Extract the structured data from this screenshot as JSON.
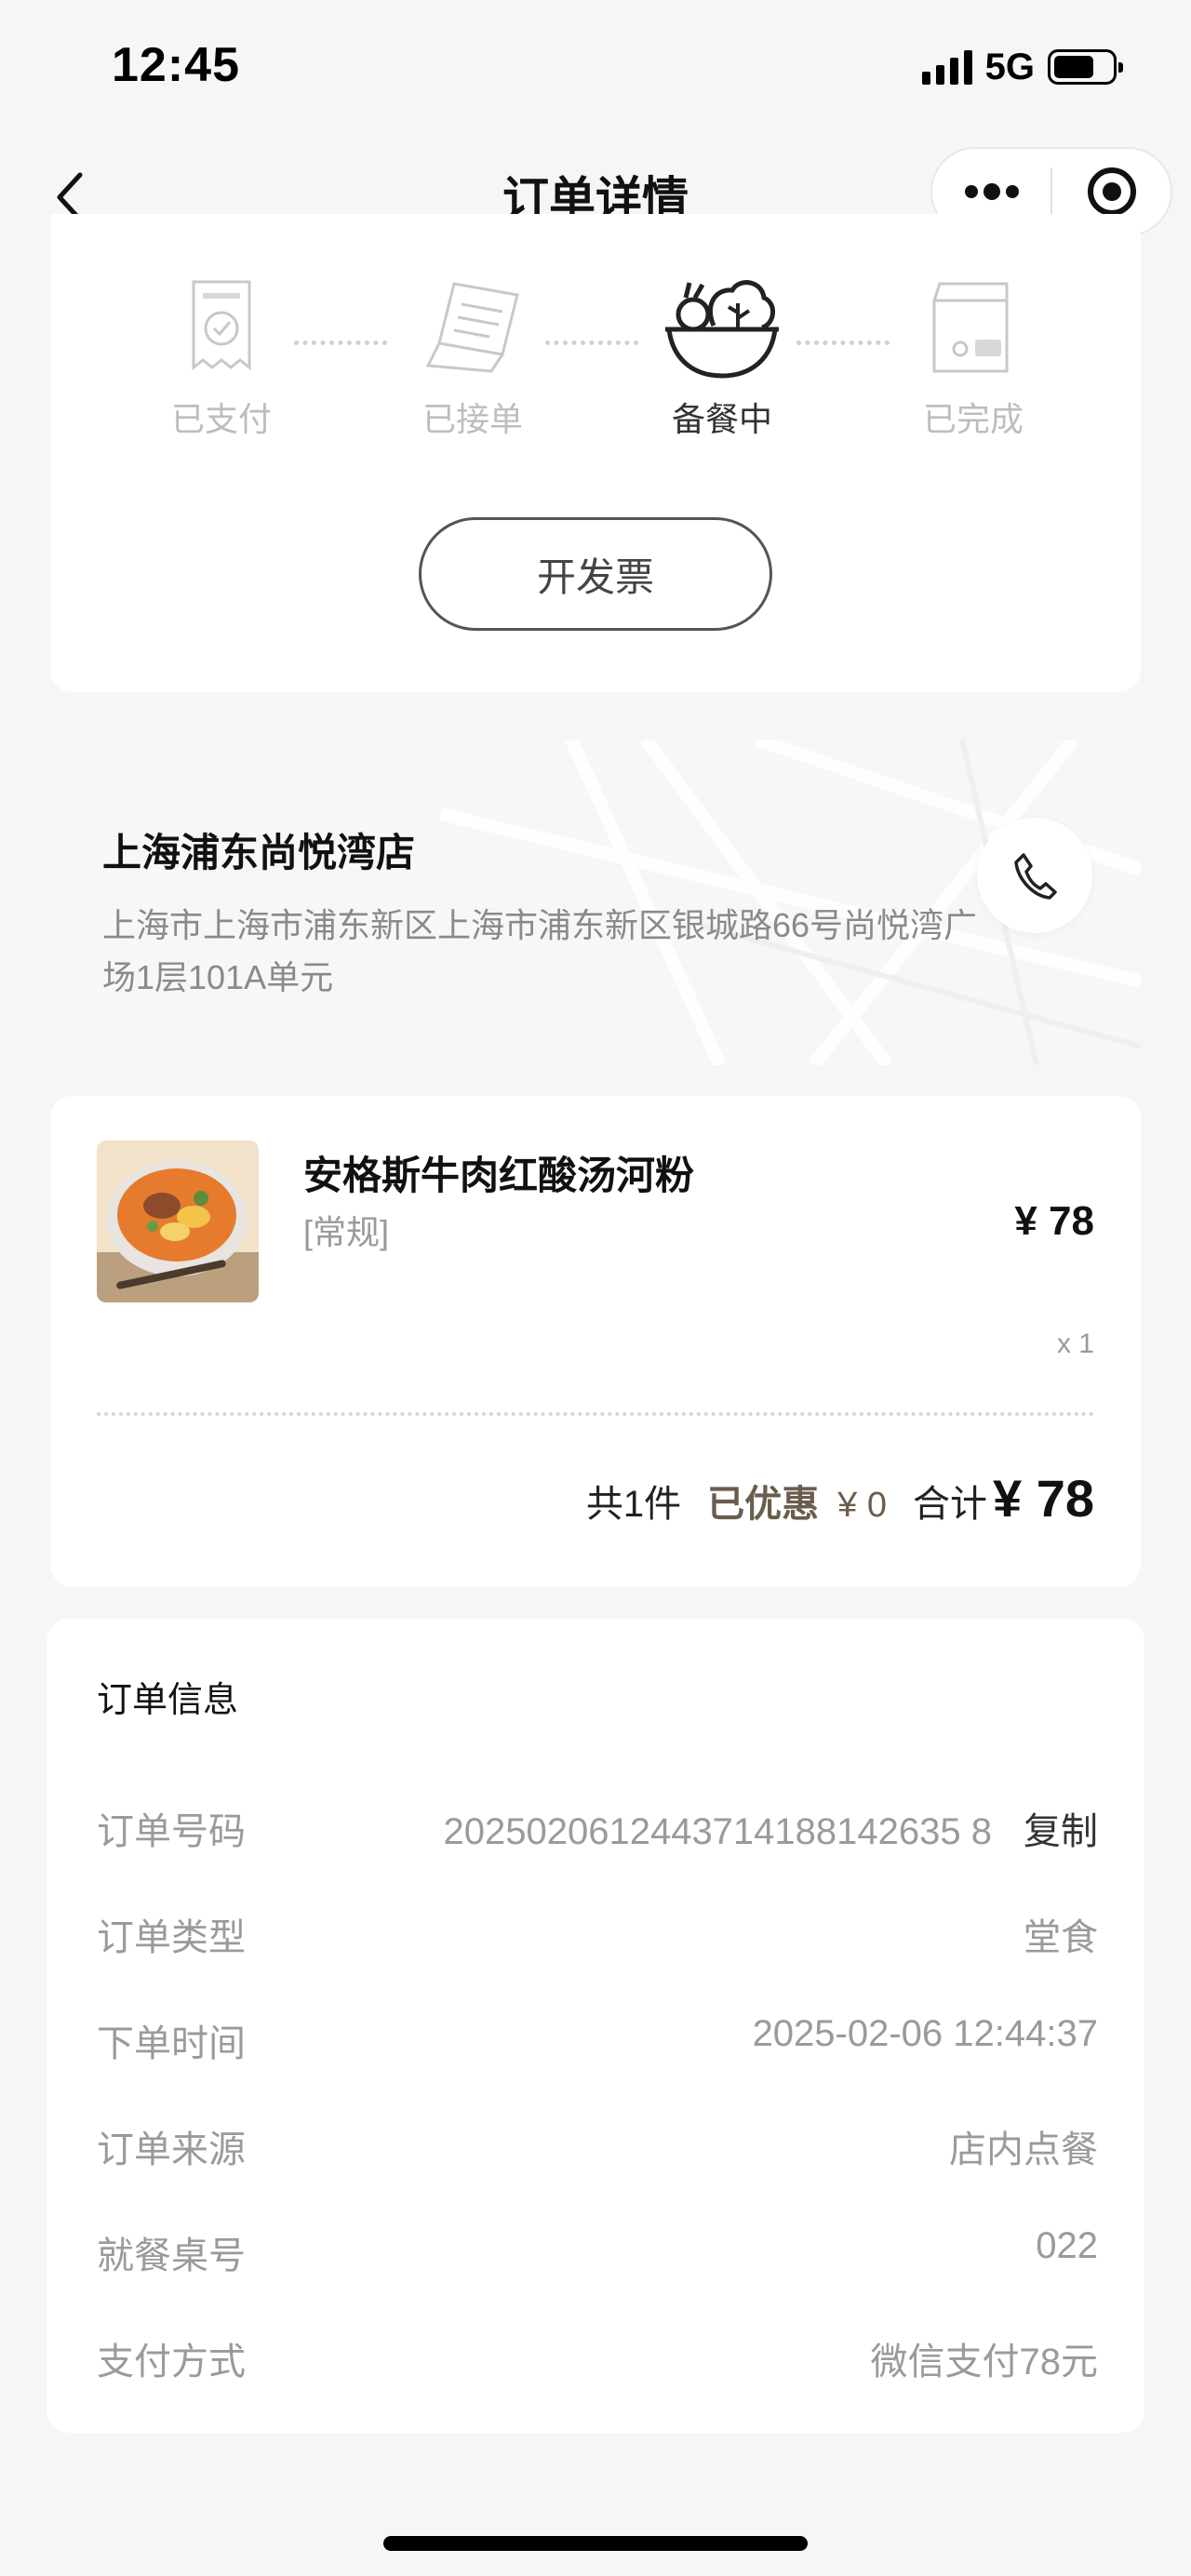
{
  "status_bar": {
    "time": "12:45",
    "network": "5G"
  },
  "nav": {
    "title": "订单详情"
  },
  "progress": {
    "steps": [
      {
        "label": "已支付",
        "icon": "receipt-check-icon",
        "active": false
      },
      {
        "label": "已接单",
        "icon": "printed-receipt-icon",
        "active": false
      },
      {
        "label": "备餐中",
        "icon": "salad-bowl-icon",
        "active": true
      },
      {
        "label": "已完成",
        "icon": "takeout-bag-icon",
        "active": false
      }
    ],
    "invoice_button": "开发票"
  },
  "store": {
    "name": "上海浦东尚悦湾店",
    "address": "上海市上海市浦东新区上海市浦东新区银城路66号尚悦湾广场1层101A单元"
  },
  "item": {
    "name": "安格斯牛肉红酸汤河粉",
    "spec": "[常规]",
    "price": "¥ 78",
    "qty": "x 1"
  },
  "summary": {
    "count": "共1件",
    "discount_label": "已优惠",
    "discount_value": "¥ 0",
    "total_label": "合计",
    "total_value": "¥ 78"
  },
  "order_info": {
    "title": "订单信息",
    "rows": [
      {
        "label": "订单号码",
        "value": "2025020612443714188142635 8"
      },
      {
        "label": "订单类型",
        "value": "堂食"
      },
      {
        "label": "下单时间",
        "value": "2025-02-06 12:44:37"
      },
      {
        "label": "订单来源",
        "value": "店内点餐"
      },
      {
        "label": "就餐桌号",
        "value": "022"
      },
      {
        "label": "支付方式",
        "value": "微信支付78元"
      }
    ],
    "copy_label": "复制"
  },
  "colors": {
    "accent_brown": "#6b5d4d",
    "muted_gray": "#9a9a9a",
    "background": "#f6f6f7"
  }
}
